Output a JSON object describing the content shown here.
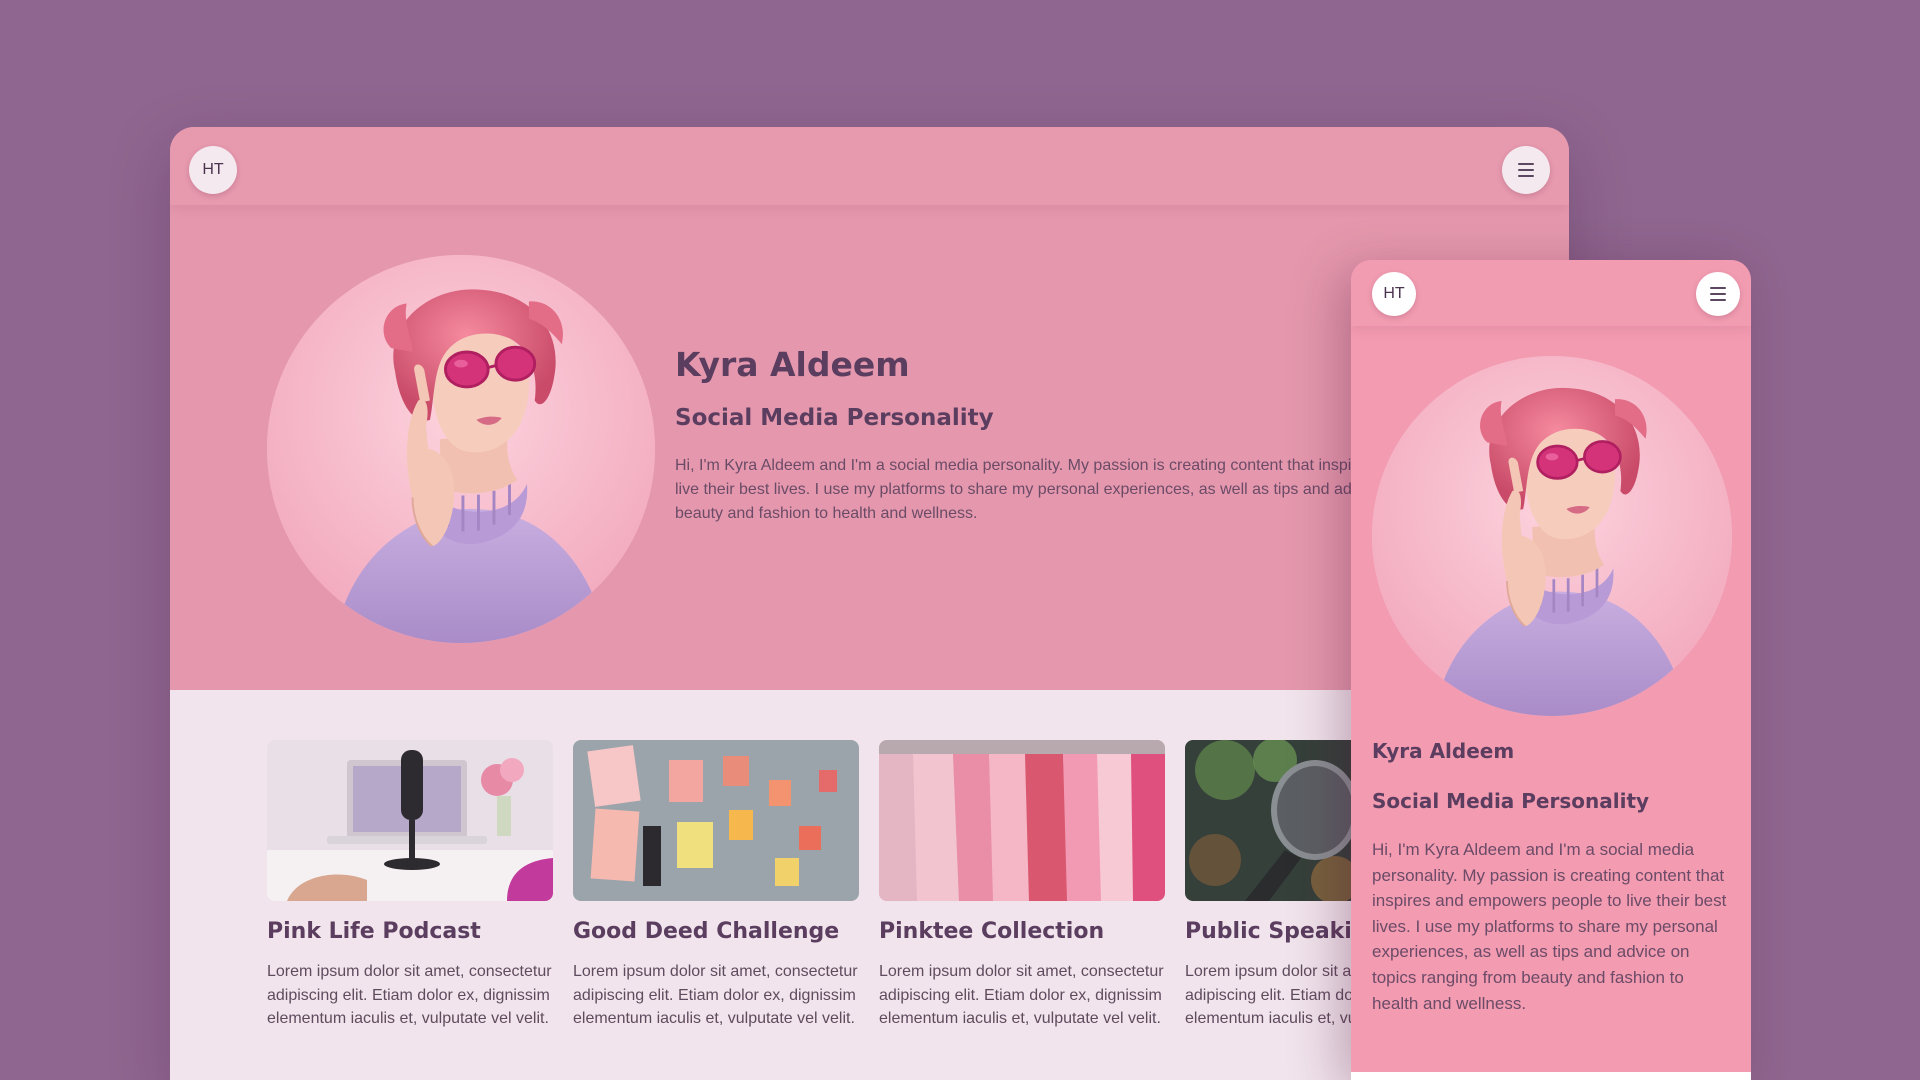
{
  "colors": {
    "page_bg": "#8f668f",
    "hero_pink": "#e598ad",
    "mobile_pink": "#f39bb1",
    "section_bg": "#f1e4ec",
    "heading": "#5a3d5f"
  },
  "desktop": {
    "nav": {
      "logo": "HT",
      "menu_icon": "hamburger-menu-icon"
    },
    "hero": {
      "name": "Kyra Aldeem",
      "role": "Social Media Personality",
      "bio": "Hi, I'm Kyra Aldeem and I'm a social media personality. My passion is creating content that inspires and empowers people to live their best lives. I use my platforms to share my personal experiences, as well as tips and advice on topics ranging from beauty and fashion to health and wellness."
    },
    "projects": [
      {
        "title": "Pink Life Podcast",
        "text": "Lorem ipsum dolor sit amet, consectetur adipiscing elit. Etiam dolor ex, dignissim elementum iaculis et, vulputate vel velit."
      },
      {
        "title": "Good Deed Challenge",
        "text": "Lorem ipsum dolor sit amet, consectetur adipiscing elit. Etiam dolor ex, dignissim elementum iaculis et, vulputate vel velit."
      },
      {
        "title": "Pinktee Collection",
        "text": "Lorem ipsum dolor sit amet, consectetur adipiscing elit. Etiam dolor ex, dignissim elementum iaculis et, vulputate vel velit."
      },
      {
        "title": "Public Speaking",
        "text": "Lorem ipsum dolor sit amet, consectetur adipiscing elit. Etiam dolor ex, dignissim elementum iaculis et, vulputate vel velit."
      }
    ]
  },
  "mobile": {
    "nav": {
      "logo": "HT",
      "menu_icon": "hamburger-menu-icon"
    },
    "hero": {
      "name": "Kyra Aldeem",
      "role": "Social Media Personality",
      "bio": "Hi, I'm Kyra Aldeem and I'm a social media personality. My passion is creating content that inspires and empowers people to live their best lives. I use my platforms to share my personal experiences, as well as tips and advice on topics ranging from beauty and fashion to health and wellness."
    }
  }
}
